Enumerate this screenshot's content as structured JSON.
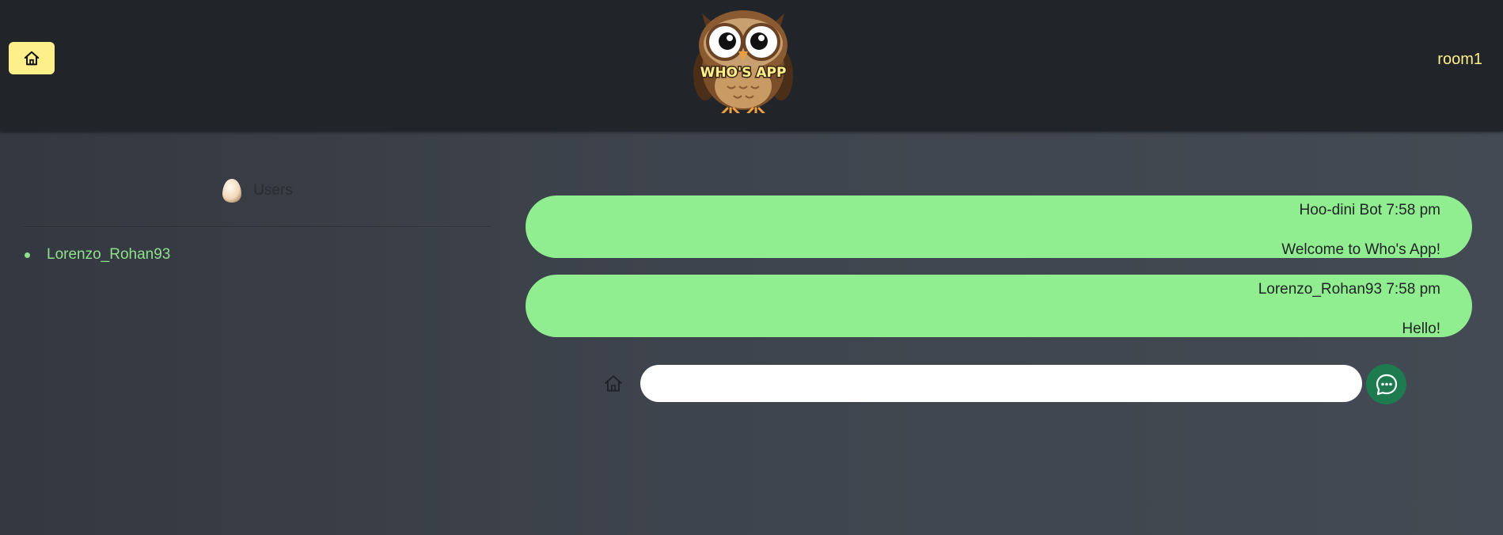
{
  "header": {
    "home_icon": "home-icon",
    "logo_text": "WHO'S APP",
    "room": "room1",
    "accent_color": "#fdf08a"
  },
  "users_panel": {
    "icon": "egg-icon",
    "title": "Users",
    "users": [
      "Lorenzo_Rohan93"
    ]
  },
  "messages": [
    {
      "meta": "Hoo-dini Bot 7:58 pm",
      "text": "Welcome to Who's App!"
    },
    {
      "meta": "Lorenzo_Rohan93 7:58 pm",
      "text": "Hello!"
    }
  ],
  "composer": {
    "value": "",
    "placeholder": "",
    "home_icon": "home-icon",
    "send_icon": "chat-send-icon"
  },
  "colors": {
    "header_bg": "#212429",
    "bubble": "#90ee90",
    "user_name": "#8fe08d",
    "send_button": "#1e7a4f"
  }
}
